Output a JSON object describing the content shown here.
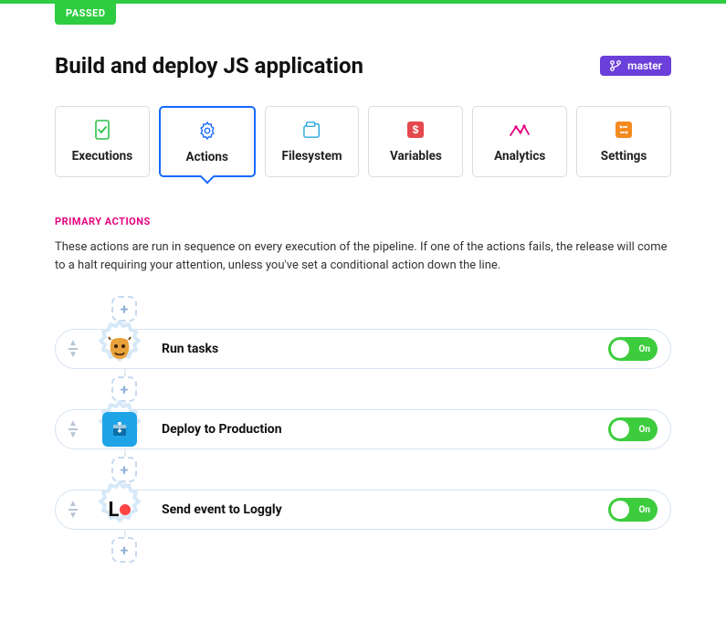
{
  "status": "PASSED",
  "title": "Build and deploy JS application",
  "branch": {
    "label": "master"
  },
  "tabs": [
    {
      "label": "Executions"
    },
    {
      "label": "Actions"
    },
    {
      "label": "Filesystem"
    },
    {
      "label": "Variables"
    },
    {
      "label": "Analytics"
    },
    {
      "label": "Settings"
    }
  ],
  "active_tab_index": 1,
  "section": {
    "heading": "PRIMARY ACTIONS",
    "description": "These actions are run in sequence on every execution of the pipeline. If one of the actions fails, the release will come to a halt requiring your attention, unless you've set a conditional action down the line."
  },
  "actions": [
    {
      "label": "Run tasks",
      "toggle": "On",
      "icon": "grunt"
    },
    {
      "label": "Deploy to Production",
      "toggle": "On",
      "icon": "server"
    },
    {
      "label": "Send event to Loggly",
      "toggle": "On",
      "icon": "loggly"
    }
  ],
  "colors": {
    "accent_green": "#2ecc40",
    "accent_blue": "#1769ff",
    "accent_purple": "#6b3fd9",
    "accent_pink": "#e6007e"
  }
}
